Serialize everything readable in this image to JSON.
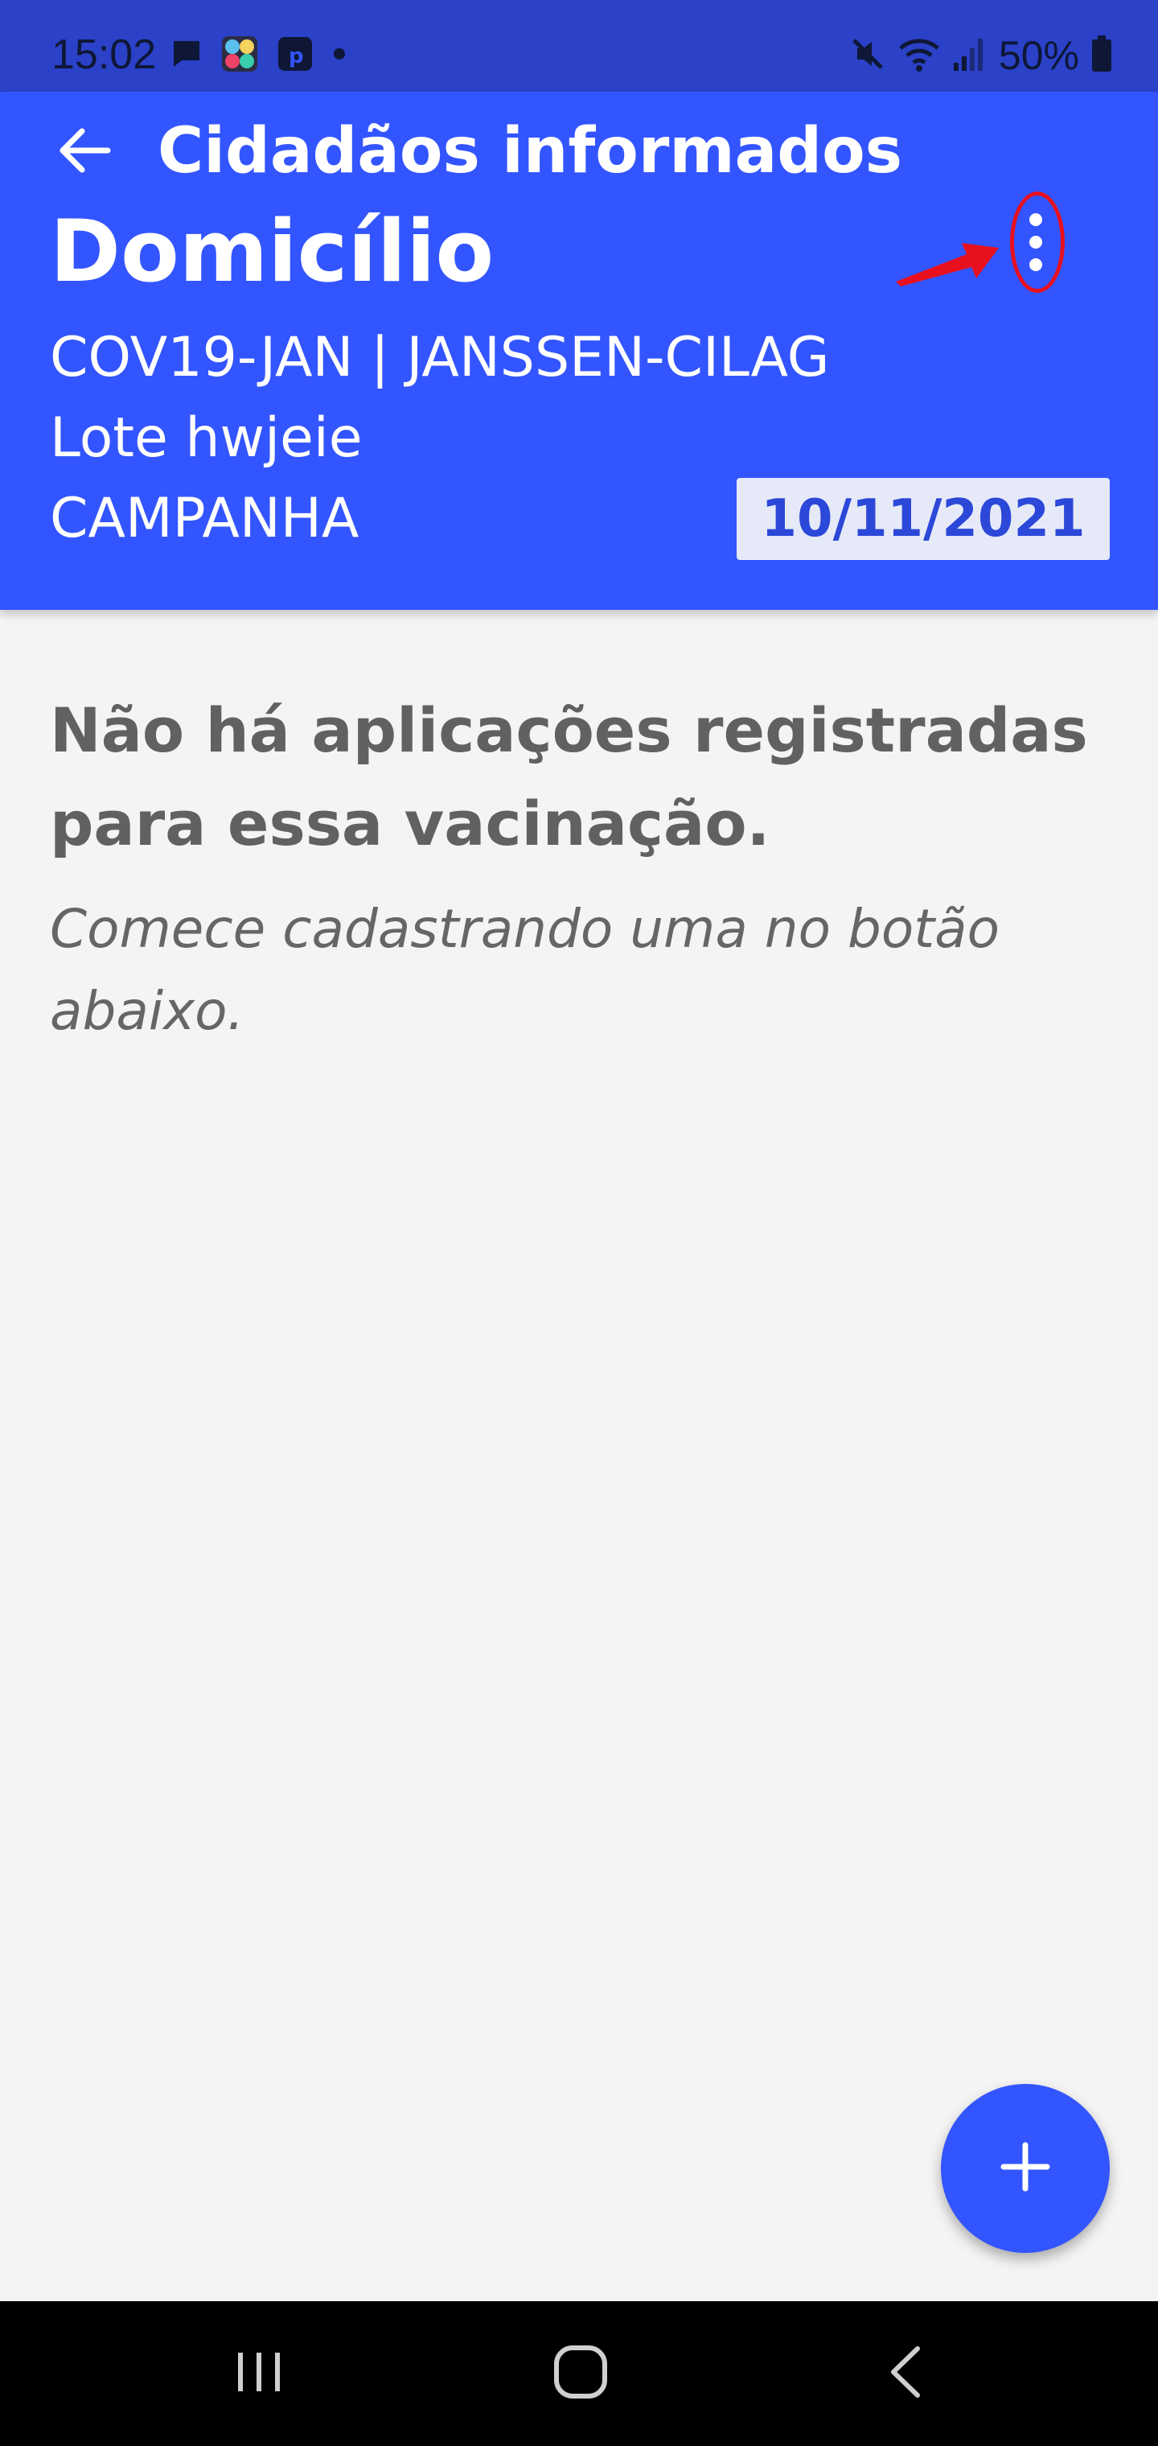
{
  "status_bar": {
    "time": "15:02",
    "battery": "50%"
  },
  "header": {
    "toolbar_title": "Cidadãos informados",
    "title": "Domicílio",
    "vaccine": "COV19-JAN | JANSSEN-CILAG",
    "lote": "Lote hwjeie",
    "strategy": "CAMPANHA",
    "date": "10/11/2021"
  },
  "empty_state": {
    "title": "Não há aplicações registradas para essa vacinação.",
    "subtitle": "Comece cadastrando uma no botão abaixo."
  },
  "colors": {
    "primary": "#3355ff",
    "status_bar": "#2a41c8",
    "annotation": "#e8101e",
    "background": "#f4f4f4"
  },
  "icons": {
    "back": "arrow-left-icon",
    "more": "more-vert-icon",
    "fab": "plus-icon",
    "nav_recents": "recents-icon",
    "nav_home": "home-icon",
    "nav_back": "chevron-left-icon"
  }
}
